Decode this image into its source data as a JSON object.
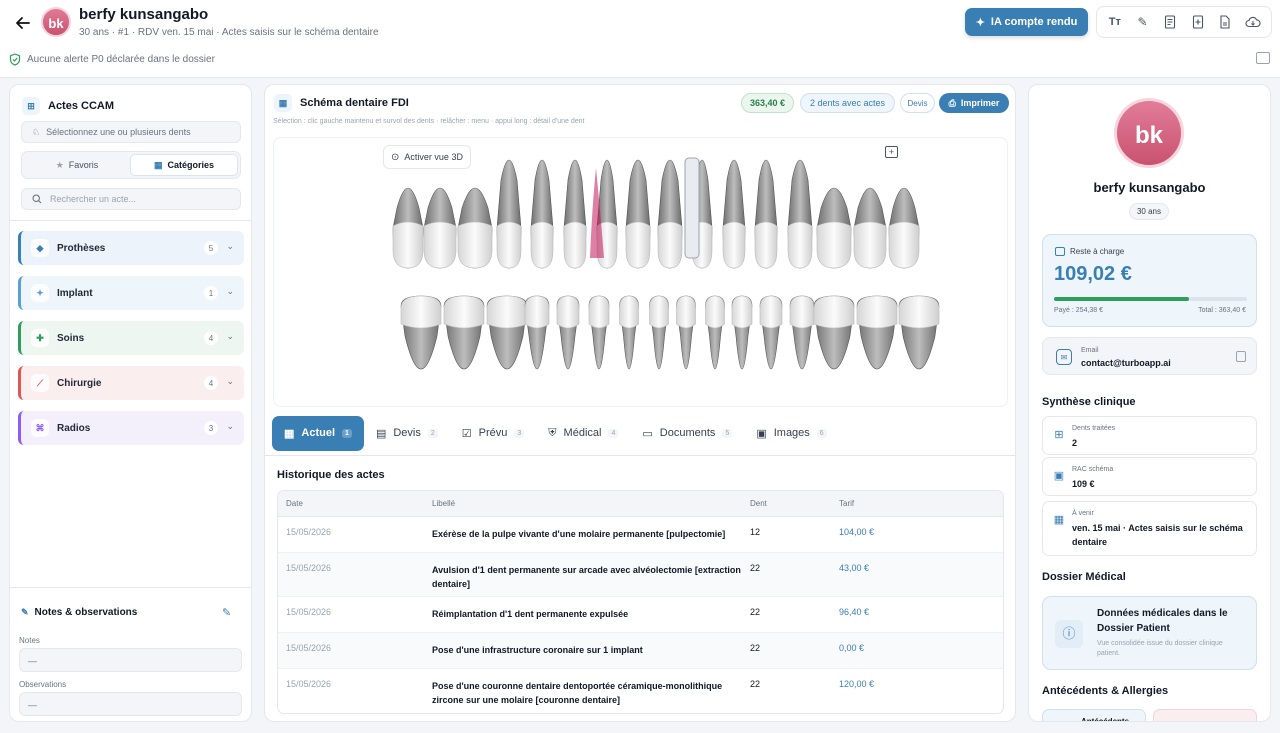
{
  "header": {
    "back_icon": "arrow-left-icon",
    "avatar_initials": "bk",
    "patient_name": "berfy kunsangabo",
    "subtitle": "30 ans · #1 · RDV ven. 15 mai · Actes saisis sur le schéma dentaire",
    "alert": "Aucune alerte P0 déclarée dans le dossier",
    "ia_button": "IA compte rendu",
    "tools": [
      "text-size-icon",
      "pencil-icon",
      "receipt-icon",
      "document-plus-icon",
      "document-icon",
      "cloud-download-icon"
    ]
  },
  "left": {
    "title": "Actes CCAM",
    "teeth_placeholder": "Sélectionnez une ou plusieurs dents",
    "seg_favoris": "Favoris",
    "seg_categories": "Catégories",
    "search_placeholder": "Rechercher un acte...",
    "categories": [
      {
        "label": "Prothèses",
        "count": "5",
        "color": "#3a7fb4"
      },
      {
        "label": "Implant",
        "count": "1",
        "color": "#5aa0d8"
      },
      {
        "label": "Soins",
        "count": "4",
        "color": "#2f9e5d"
      },
      {
        "label": "Chirurgie",
        "count": "4",
        "color": "#e05555"
      },
      {
        "label": "Radios",
        "count": "3",
        "color": "#8b5cf6"
      }
    ],
    "notes_title": "Notes & observations",
    "notes_label": "Notes",
    "notes_value": "—",
    "obs_label": "Observations",
    "obs_value": "—"
  },
  "center": {
    "title": "Schéma dentaire FDI",
    "subtitle": "Sélection : clic gauche maintenu et survol des dents · relâcher : menu · appui long : détail d'une dent",
    "badge_amount": "363,40 €",
    "badge_teeth": "2 dents avec actes",
    "badge_devis": "Devis",
    "print_label": "Imprimer",
    "vue3d_label": "Activer vue 3D",
    "tabs": [
      {
        "label": "Actuel",
        "count": "1"
      },
      {
        "label": "Devis",
        "count": "2"
      },
      {
        "label": "Prévu",
        "count": "3"
      },
      {
        "label": "Médical",
        "count": "4"
      },
      {
        "label": "Documents",
        "count": "5"
      },
      {
        "label": "Images",
        "count": "6"
      }
    ],
    "history_title": "Historique des actes",
    "columns": [
      "Date",
      "Libellé",
      "Dent",
      "Tarif"
    ],
    "rows": [
      {
        "date": "15/05/2026",
        "libelle": "Exérèse de la pulpe vivante d'une molaire permanente [pulpectomie]",
        "dent": "12",
        "tarif": "104,00 €"
      },
      {
        "date": "15/05/2026",
        "libelle": "Avulsion d'1 dent permanente sur arcade avec alvéolectomie [extraction dentaire]",
        "dent": "22",
        "tarif": "43,00 €"
      },
      {
        "date": "15/05/2026",
        "libelle": "Réimplantation d'1 dent permanente expulsée",
        "dent": "22",
        "tarif": "96,40 €"
      },
      {
        "date": "15/05/2026",
        "libelle": "Pose d'une infrastructure coronaire sur 1 implant",
        "dent": "22",
        "tarif": "0,00 €"
      },
      {
        "date": "15/05/2026",
        "libelle": "Pose d'une couronne dentaire dentoportée céramique-monolithique zircone sur une molaire [couronne dentaire]",
        "dent": "22",
        "tarif": "120,00 €"
      }
    ]
  },
  "right": {
    "avatar_initials": "bk",
    "name": "berfy kunsangabo",
    "age": "30 ans",
    "rac_label": "Reste à charge",
    "rac_value": "109,02 €",
    "paid": "Payé : 254,38 €",
    "total": "Total : 363,40 €",
    "paid_fraction": 0.7,
    "email_label": "Email",
    "email_value": "contact@turboapp.ai",
    "synthese_title": "Synthèse clinique",
    "synthese": [
      {
        "label": "Dents traitées",
        "value": "2"
      },
      {
        "label": "RAC schéma",
        "value": "109 €"
      },
      {
        "label": "À venir",
        "value": "ven. 15 mai · Actes saisis sur le schéma dentaire"
      }
    ],
    "dossier_title": "Dossier Médical",
    "dossier_card_title": "Données médicales dans le Dossier Patient",
    "dossier_card_sub": "Vue consolidée issue du dossier clinique patient.",
    "antecedents_title": "Antécédents & Allergies",
    "antecedents_card": "Antécédents"
  }
}
